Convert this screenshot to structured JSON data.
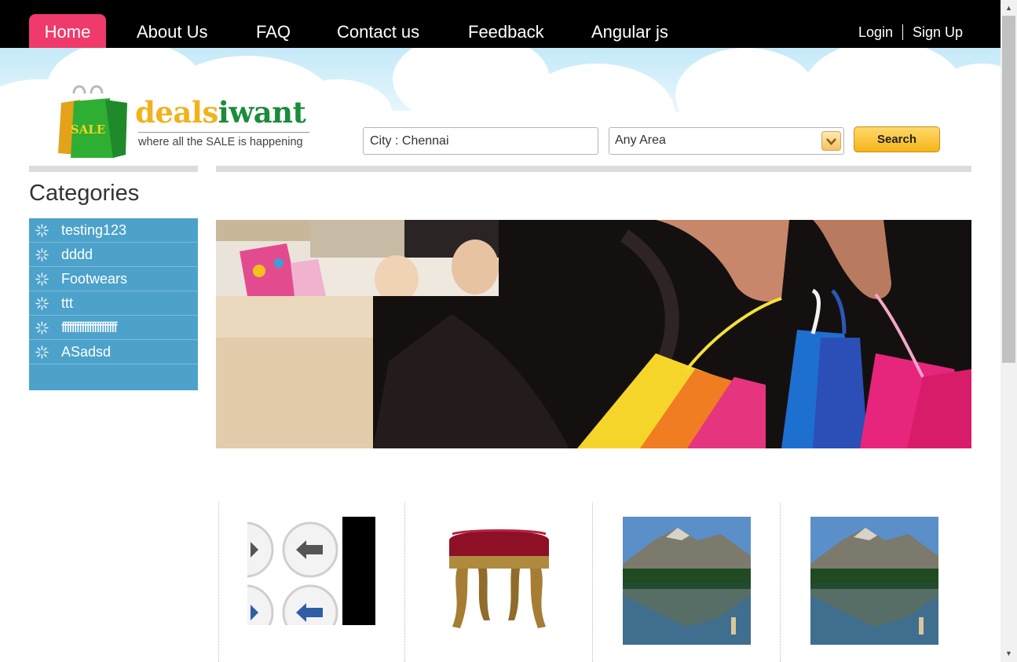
{
  "nav": {
    "items": [
      "Home",
      "About Us",
      "FAQ",
      "Contact us",
      "Feedback",
      "Angular js"
    ],
    "login": "Login",
    "signup": "Sign Up",
    "active_color": "#ee3b6b"
  },
  "logo": {
    "brand_main": "deals",
    "brand_accent": "iwant",
    "tagline": "where all the SALE is happening",
    "bag_text": "SALE"
  },
  "search": {
    "city_value": "City : Chennai",
    "area_value": "Any Area",
    "button_label": "Search"
  },
  "categories": {
    "title": "Categories",
    "items": [
      "testing123",
      "dddd",
      "Footwears",
      "ttt",
      "ffffffffffffffffffffff",
      "ASadsd"
    ],
    "bg_color": "#4ca2ca"
  },
  "products": [
    {
      "icon": "arrow-buttons-image",
      "label": "...."
    },
    {
      "icon": "stool-image",
      "label": "...."
    },
    {
      "icon": "mountain-lake-image",
      "label": "...."
    },
    {
      "icon": "mountain-lake-image",
      "label": "...."
    }
  ]
}
